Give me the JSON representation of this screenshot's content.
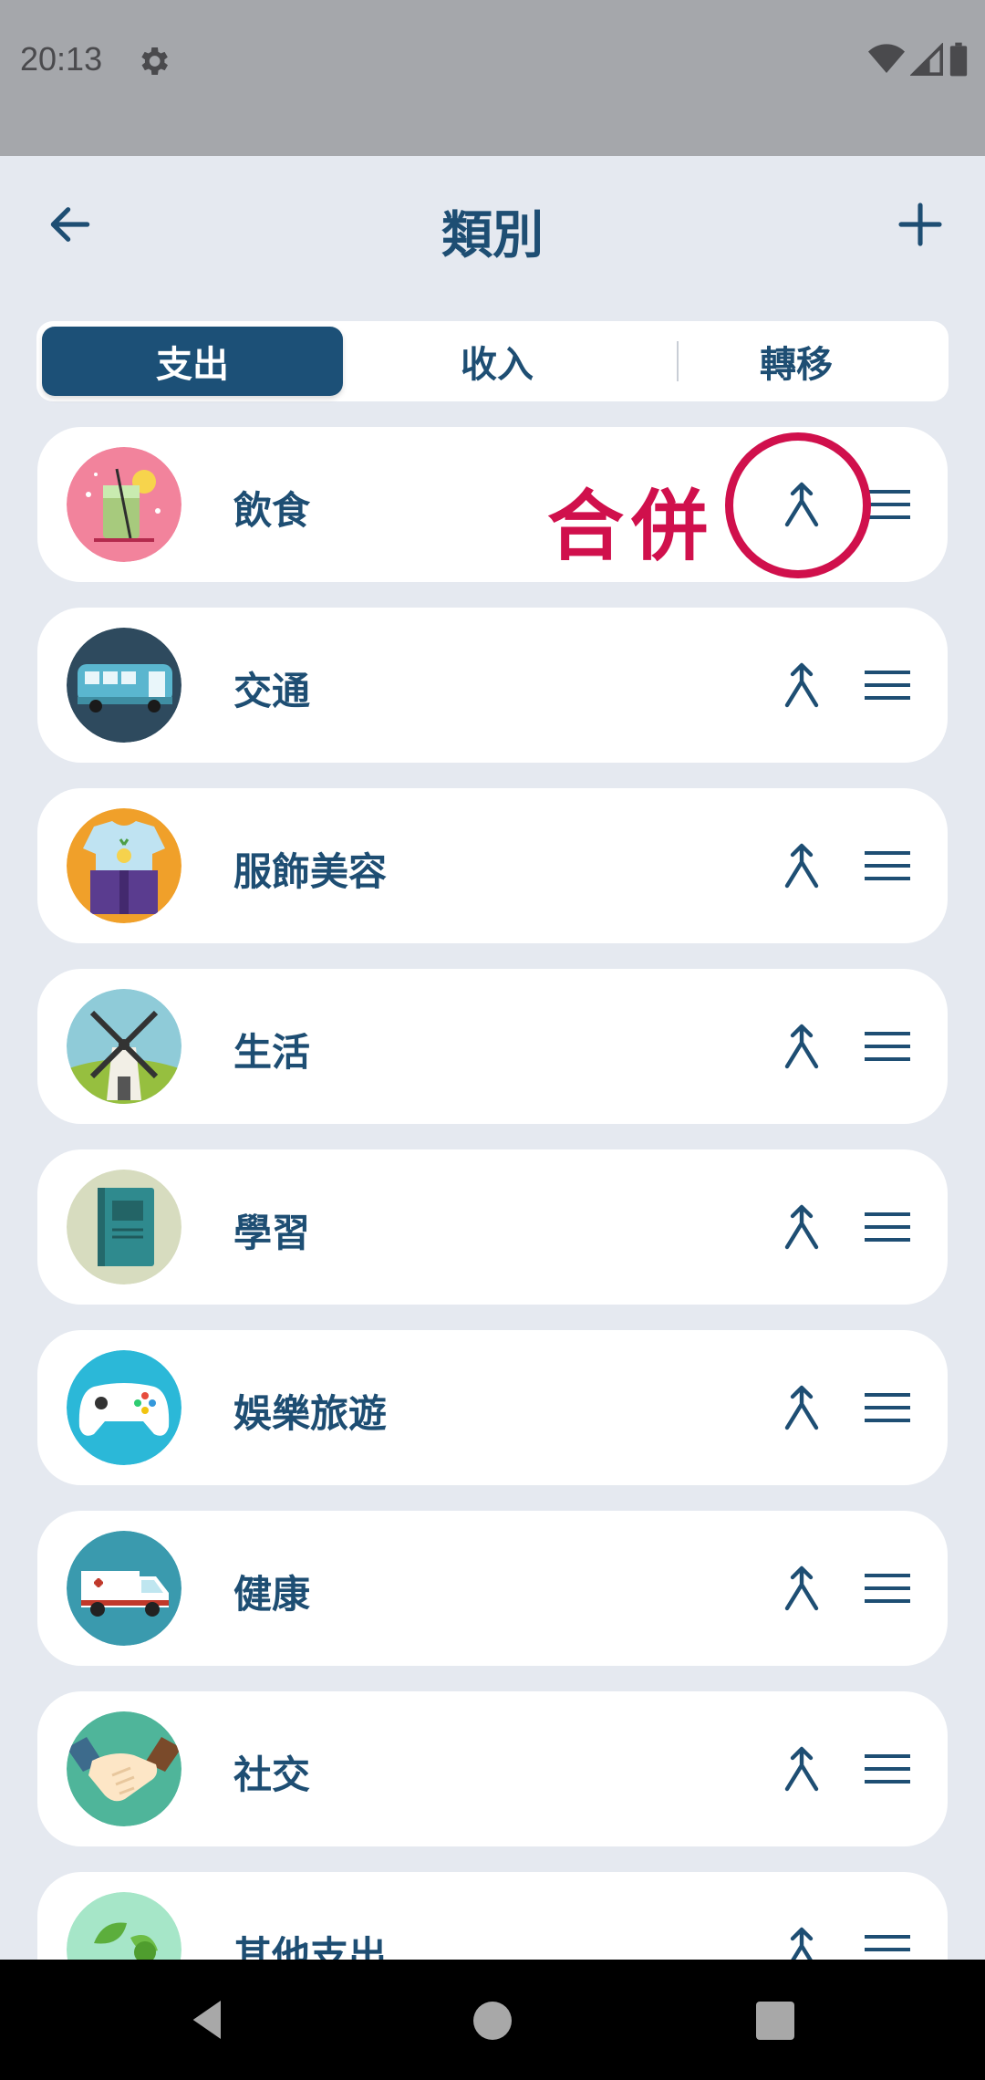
{
  "status_bar": {
    "time": "20:13"
  },
  "app_bar": {
    "title": "類別"
  },
  "tabs": [
    {
      "label": "支出",
      "active": true
    },
    {
      "label": "收入",
      "active": false
    },
    {
      "label": "轉移",
      "active": false
    }
  ],
  "annotation": {
    "text": "合併",
    "color": "#d0104c"
  },
  "categories": [
    {
      "label": "飲食",
      "icon": "drink-icon"
    },
    {
      "label": "交通",
      "icon": "bus-icon"
    },
    {
      "label": "服飾美容",
      "icon": "clothing-icon"
    },
    {
      "label": "生活",
      "icon": "windmill-icon"
    },
    {
      "label": "學習",
      "icon": "book-icon"
    },
    {
      "label": "娛樂旅遊",
      "icon": "gamepad-icon"
    },
    {
      "label": "健康",
      "icon": "ambulance-icon"
    },
    {
      "label": "社交",
      "icon": "handshake-icon"
    },
    {
      "label": "其他支出",
      "icon": "leaf-icon"
    }
  ],
  "colors": {
    "accent": "#1c5077",
    "text": "#1e4e73",
    "background": "#e5e9f0",
    "annotation": "#d0104c"
  }
}
